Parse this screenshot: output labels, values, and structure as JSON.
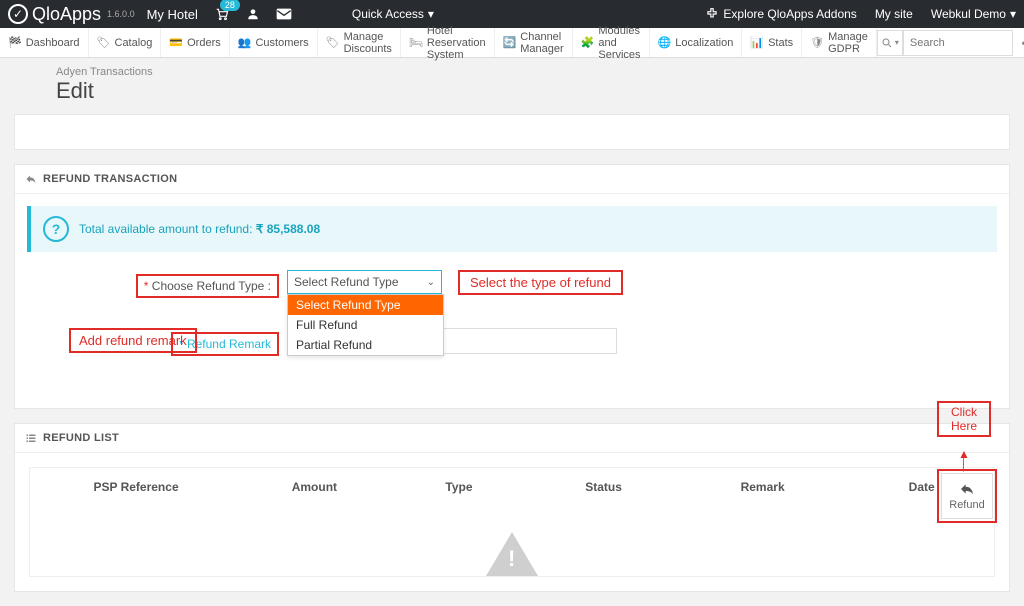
{
  "topbar": {
    "brand": "QloApps",
    "version": "1.6.0.0",
    "hotel": "My Hotel",
    "cart_badge": "28",
    "quick_access": "Quick Access",
    "explore": "Explore QloApps Addons",
    "mysite": "My site",
    "userDemo": "Webkul Demo"
  },
  "nav": {
    "dashboard": "Dashboard",
    "catalog": "Catalog",
    "orders": "Orders",
    "customers": "Customers",
    "discounts": "Manage Discounts",
    "hotel": "Hotel Reservation System",
    "channel": "Channel Manager",
    "modules": "Modules and Services",
    "localization": "Localization",
    "stats": "Stats",
    "gdpr": "Manage GDPR",
    "search_ph": "Search"
  },
  "breadcrumb": "Adyen Transactions",
  "page_title": "Edit",
  "refund_panel": {
    "heading": "REFUND TRANSACTION",
    "info_prefix": "Total available amount to refund: ",
    "info_amount": "₹ 85,588.08",
    "label_choose": "Choose Refund Type :",
    "label_remark": "Refund Remark",
    "select_placeholder": "Select Refund Type",
    "options": {
      "opt0": "Select Refund Type",
      "opt1": "Full Refund",
      "opt2": "Partial Refund"
    },
    "annot_select": "Select the type of refund",
    "annot_remark": "Add refund remark",
    "refund_btn": "Refund",
    "annot_click": "Click Here"
  },
  "list_panel": {
    "heading": "REFUND LIST",
    "cols": {
      "psp": "PSP Reference",
      "amt": "Amount",
      "type": "Type",
      "status": "Status",
      "remark": "Remark",
      "date": "Date"
    }
  }
}
